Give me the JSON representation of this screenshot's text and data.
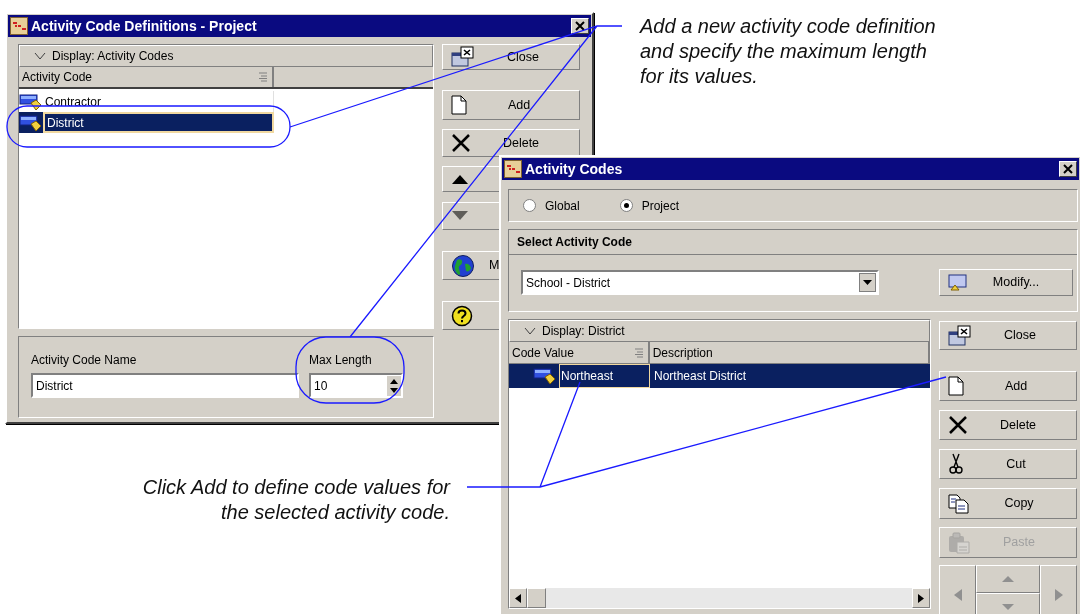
{
  "definitions_window": {
    "title": "Activity Code Definitions - Project",
    "display_bar": "Display: Activity Codes",
    "columns": [
      "Activity Code"
    ],
    "rows": [
      {
        "name": "Contractor",
        "selected": false
      },
      {
        "name": "District",
        "selected": true
      }
    ],
    "buttons": [
      {
        "kind": "close",
        "label": "Close",
        "disabled": false
      },
      {
        "kind": "add",
        "label": "Add",
        "disabled": false
      },
      {
        "kind": "delete",
        "label": "Delete",
        "disabled": false
      },
      {
        "kind": "up",
        "disabled": false
      },
      {
        "kind": "down",
        "disabled": true
      },
      {
        "kind": "globe",
        "label": "M",
        "disabled": false
      },
      {
        "kind": "help",
        "disabled": false
      }
    ],
    "name_field": {
      "label": "Activity Code Name",
      "value": "District"
    },
    "max_length_field": {
      "label": "Max Length",
      "value": "10"
    }
  },
  "codes_window": {
    "title": "Activity Codes",
    "scope": [
      {
        "label": "Global",
        "selected": false
      },
      {
        "label": "Project",
        "selected": true
      }
    ],
    "section": "Select Activity Code",
    "code_select": {
      "value": "School - District"
    },
    "modify_button": "Modify...",
    "display_bar": "Display: District",
    "columns": [
      "Code Value",
      "Description"
    ],
    "rows": [
      {
        "code_value": "Northeast",
        "description": "Northeast District",
        "selected": true
      }
    ],
    "buttons": [
      {
        "kind": "close",
        "label": "Close",
        "disabled": false
      },
      {
        "kind": "add",
        "label": "Add",
        "disabled": false
      },
      {
        "kind": "delete",
        "label": "Delete",
        "disabled": false
      },
      {
        "kind": "cut",
        "label": "Cut",
        "disabled": false
      },
      {
        "kind": "copy",
        "label": "Copy",
        "disabled": false
      },
      {
        "kind": "paste",
        "label": "Paste",
        "disabled": true
      }
    ]
  },
  "callouts": [
    {
      "text": "Add a new activity code definition and specify the maximum length for its values."
    },
    {
      "text": "Click Add to define code values for the selected activity code."
    }
  ]
}
